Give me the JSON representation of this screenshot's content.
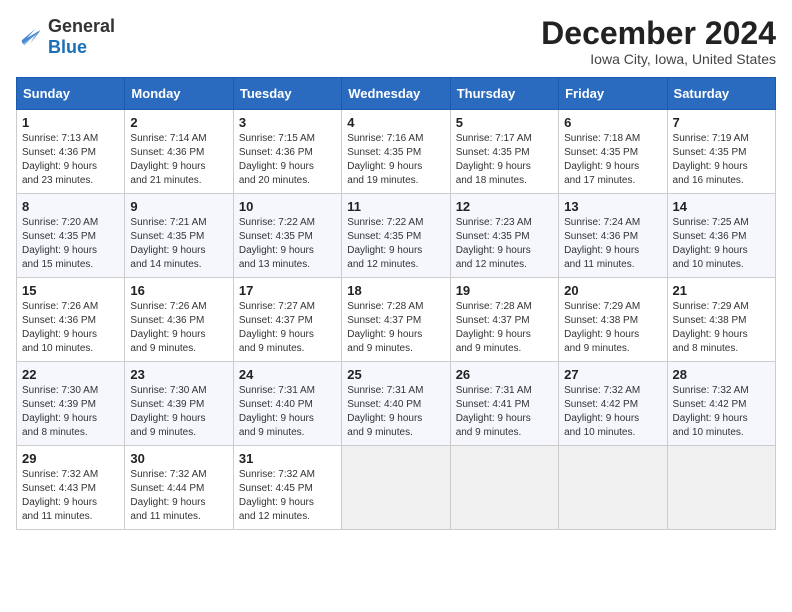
{
  "header": {
    "logo_general": "General",
    "logo_blue": "Blue",
    "title": "December 2024",
    "subtitle": "Iowa City, Iowa, United States"
  },
  "columns": [
    "Sunday",
    "Monday",
    "Tuesday",
    "Wednesday",
    "Thursday",
    "Friday",
    "Saturday"
  ],
  "weeks": [
    [
      {
        "day": "1",
        "info": "Sunrise: 7:13 AM\nSunset: 4:36 PM\nDaylight: 9 hours\nand 23 minutes."
      },
      {
        "day": "2",
        "info": "Sunrise: 7:14 AM\nSunset: 4:36 PM\nDaylight: 9 hours\nand 21 minutes."
      },
      {
        "day": "3",
        "info": "Sunrise: 7:15 AM\nSunset: 4:36 PM\nDaylight: 9 hours\nand 20 minutes."
      },
      {
        "day": "4",
        "info": "Sunrise: 7:16 AM\nSunset: 4:35 PM\nDaylight: 9 hours\nand 19 minutes."
      },
      {
        "day": "5",
        "info": "Sunrise: 7:17 AM\nSunset: 4:35 PM\nDaylight: 9 hours\nand 18 minutes."
      },
      {
        "day": "6",
        "info": "Sunrise: 7:18 AM\nSunset: 4:35 PM\nDaylight: 9 hours\nand 17 minutes."
      },
      {
        "day": "7",
        "info": "Sunrise: 7:19 AM\nSunset: 4:35 PM\nDaylight: 9 hours\nand 16 minutes."
      }
    ],
    [
      {
        "day": "8",
        "info": "Sunrise: 7:20 AM\nSunset: 4:35 PM\nDaylight: 9 hours\nand 15 minutes."
      },
      {
        "day": "9",
        "info": "Sunrise: 7:21 AM\nSunset: 4:35 PM\nDaylight: 9 hours\nand 14 minutes."
      },
      {
        "day": "10",
        "info": "Sunrise: 7:22 AM\nSunset: 4:35 PM\nDaylight: 9 hours\nand 13 minutes."
      },
      {
        "day": "11",
        "info": "Sunrise: 7:22 AM\nSunset: 4:35 PM\nDaylight: 9 hours\nand 12 minutes."
      },
      {
        "day": "12",
        "info": "Sunrise: 7:23 AM\nSunset: 4:35 PM\nDaylight: 9 hours\nand 12 minutes."
      },
      {
        "day": "13",
        "info": "Sunrise: 7:24 AM\nSunset: 4:36 PM\nDaylight: 9 hours\nand 11 minutes."
      },
      {
        "day": "14",
        "info": "Sunrise: 7:25 AM\nSunset: 4:36 PM\nDaylight: 9 hours\nand 10 minutes."
      }
    ],
    [
      {
        "day": "15",
        "info": "Sunrise: 7:26 AM\nSunset: 4:36 PM\nDaylight: 9 hours\nand 10 minutes."
      },
      {
        "day": "16",
        "info": "Sunrise: 7:26 AM\nSunset: 4:36 PM\nDaylight: 9 hours\nand 9 minutes."
      },
      {
        "day": "17",
        "info": "Sunrise: 7:27 AM\nSunset: 4:37 PM\nDaylight: 9 hours\nand 9 minutes."
      },
      {
        "day": "18",
        "info": "Sunrise: 7:28 AM\nSunset: 4:37 PM\nDaylight: 9 hours\nand 9 minutes."
      },
      {
        "day": "19",
        "info": "Sunrise: 7:28 AM\nSunset: 4:37 PM\nDaylight: 9 hours\nand 9 minutes."
      },
      {
        "day": "20",
        "info": "Sunrise: 7:29 AM\nSunset: 4:38 PM\nDaylight: 9 hours\nand 9 minutes."
      },
      {
        "day": "21",
        "info": "Sunrise: 7:29 AM\nSunset: 4:38 PM\nDaylight: 9 hours\nand 8 minutes."
      }
    ],
    [
      {
        "day": "22",
        "info": "Sunrise: 7:30 AM\nSunset: 4:39 PM\nDaylight: 9 hours\nand 8 minutes."
      },
      {
        "day": "23",
        "info": "Sunrise: 7:30 AM\nSunset: 4:39 PM\nDaylight: 9 hours\nand 9 minutes."
      },
      {
        "day": "24",
        "info": "Sunrise: 7:31 AM\nSunset: 4:40 PM\nDaylight: 9 hours\nand 9 minutes."
      },
      {
        "day": "25",
        "info": "Sunrise: 7:31 AM\nSunset: 4:40 PM\nDaylight: 9 hours\nand 9 minutes."
      },
      {
        "day": "26",
        "info": "Sunrise: 7:31 AM\nSunset: 4:41 PM\nDaylight: 9 hours\nand 9 minutes."
      },
      {
        "day": "27",
        "info": "Sunrise: 7:32 AM\nSunset: 4:42 PM\nDaylight: 9 hours\nand 10 minutes."
      },
      {
        "day": "28",
        "info": "Sunrise: 7:32 AM\nSunset: 4:42 PM\nDaylight: 9 hours\nand 10 minutes."
      }
    ],
    [
      {
        "day": "29",
        "info": "Sunrise: 7:32 AM\nSunset: 4:43 PM\nDaylight: 9 hours\nand 11 minutes."
      },
      {
        "day": "30",
        "info": "Sunrise: 7:32 AM\nSunset: 4:44 PM\nDaylight: 9 hours\nand 11 minutes."
      },
      {
        "day": "31",
        "info": "Sunrise: 7:32 AM\nSunset: 4:45 PM\nDaylight: 9 hours\nand 12 minutes."
      },
      null,
      null,
      null,
      null
    ]
  ]
}
